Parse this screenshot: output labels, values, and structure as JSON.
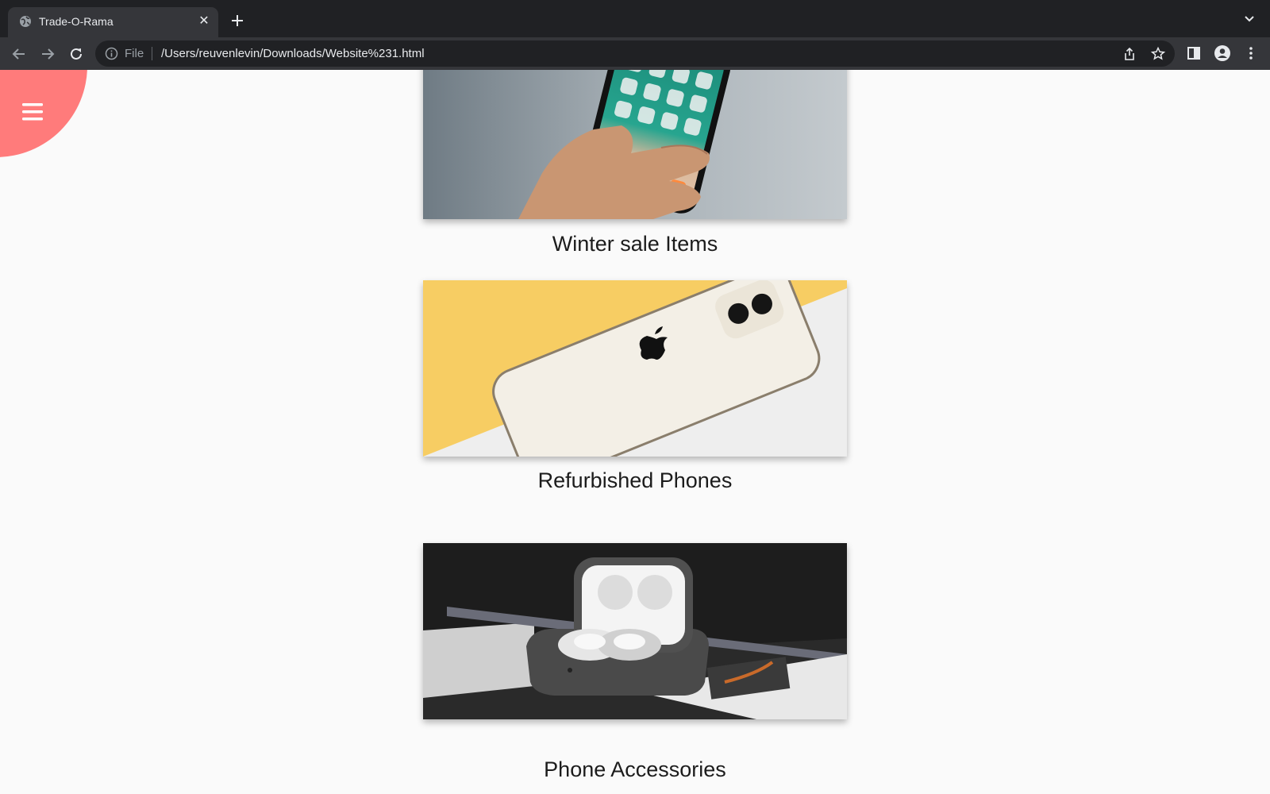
{
  "browser": {
    "tab_title": "Trade-O-Rama",
    "close_glyph": "✕",
    "scheme_label": "File",
    "url": "/Users/reuvenlevin/Downloads/Website%231.html"
  },
  "page": {
    "accent_color": "#ff7b7b",
    "sections": [
      {
        "title": "Winter sale Items",
        "image_icon": "smartphone-in-hand"
      },
      {
        "title": "Refurbished Phones",
        "image_icon": "phone-back-apple-logo"
      },
      {
        "title": "Phone Accessories",
        "image_icon": "earbuds-charging-case"
      }
    ]
  }
}
